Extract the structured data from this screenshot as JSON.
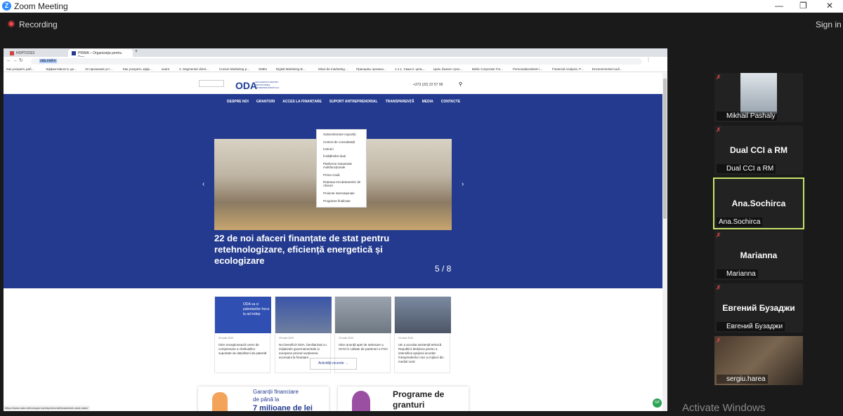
{
  "window": {
    "title": "Zoom Meeting",
    "recording": "Recording",
    "sign_in": "Sign in"
  },
  "browser": {
    "tabs": [
      {
        "label": "НОРТ/2023"
      },
      {
        "label": "PRIMA – Organizația pentru Dez"
      }
    ],
    "url": "oda.md/ro",
    "bookmarks": [
      "Как ускорить раб…",
      "Эффективность дн…",
      "10 признаков уст…",
      "Как ускорить эфф…",
      "avant",
      "2. Segmentul client…",
      "Cursuri Marketing p…",
      "SMEs",
      "Digital Marketing B…",
      "Mixul de marketing…",
      "Принципы организ…",
      "1.1.1. Смысл: цель…",
      "Цель бизнес-трен…",
      "Baltic Corporate Tra…",
      "Personalassistent-i…",
      "Financial Analysis, P…",
      "Environmental Audi…"
    ],
    "status_url": "https://www.oda.md/ro/suport-antreprenorial/invatament-dual-main/"
  },
  "site": {
    "logo": "ODA",
    "logo_sub": "ORGANIZAȚIA PENTRU DEZVOLTAREA ANTREPRENORIATULUI",
    "phone": "+373 (22) 22 57 99",
    "nav": [
      "DESPRE NOI",
      "GRANTURI",
      "ACCES LA FINANȚARE",
      "SUPORT ANTREPRENORIAL",
      "TRANSPARENȚĂ",
      "MEDIA",
      "CONTACTE"
    ],
    "dropdown": [
      "Subventionare expoziții",
      "Centrul de consultanță",
      "Instruiri",
      "Învățământ dual",
      "Platforme industriale multifuncționale",
      "Prima Casă",
      "Rețeaua Incubatoarelor de Afaceri",
      "Proiecte internaționale",
      "Programe finalizate"
    ],
    "hero_title": "22 de noi afaceri finanțate de stat pentru retehnologizare, eficiență energetică și ecologizare",
    "counter": "5 / 8",
    "cards": [
      {
        "date": "30 iunie 2023",
        "text": "ODA recepționează cereri de compensare a cheltuielilor suportate de deținătorii de patentă",
        "overlay": "ODA va ci patentarilor frece la ad indep"
      },
      {
        "date": "29 iunie 2023",
        "text": "Noi beneficii! ODA, familiarizați cu inițiativele guvernamentale și europene privind susținerea accesului la finanțare",
        "overlay": ""
      },
      {
        "date": "23 iunie 2023",
        "text": "ODA anunță apel de selectare a OCN în calitate de parteneri a FGC",
        "overlay": ""
      },
      {
        "date": "23 iunie 2023",
        "text": "UE a acordat asistență tehnică Republicii Moldova pentru a intensifica sprijinul acordat întreprinderilor mici și mijlocii din mediul rural",
        "overlay": ""
      }
    ],
    "activity_btn": "Activități recente →",
    "bottom": [
      {
        "line1": "Garanții financiare",
        "line2": "de până la",
        "line3": "7 milioane de lei"
      },
      {
        "line1": "Programe de",
        "line2": "granturi"
      }
    ],
    "ad_badge": "GP"
  },
  "participants": [
    {
      "name": "Mikhail Pashaly",
      "display": "",
      "video": true
    },
    {
      "name": "Dual CCI a RM",
      "display": "Dual CCI a RM",
      "video": false
    },
    {
      "name": "Ana.Sochirca",
      "display": "Ana.Sochirca",
      "video": false,
      "speaking": true
    },
    {
      "name": "Marianna",
      "display": "Marianna",
      "video": false
    },
    {
      "name": "Евгений Бузаджи",
      "display": "Евгений Бузаджи",
      "video": false
    },
    {
      "name": "sergiu.harea",
      "display": "",
      "video": true
    }
  ],
  "watermark": "Activate Windows"
}
